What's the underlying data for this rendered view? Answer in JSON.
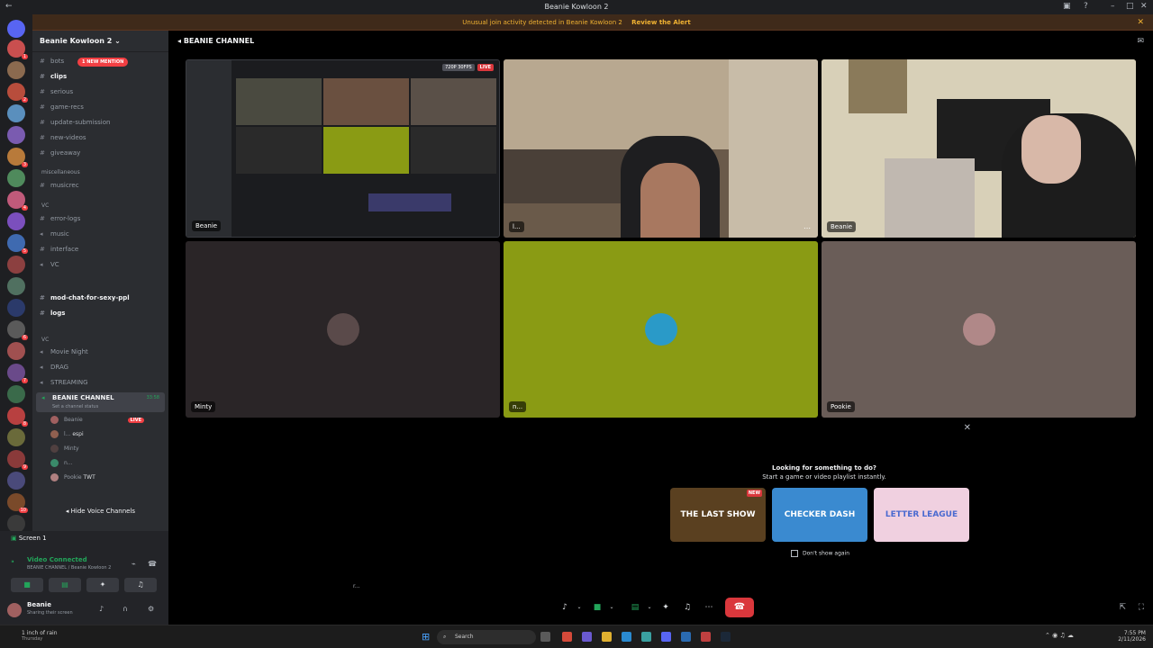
{
  "window": {
    "title": "Beanie Kowloon 2"
  },
  "alert": {
    "text": "Unusual join activity detected in Beanie Kowloon 2",
    "link": "Review the Alert"
  },
  "server_badges": [
    "1",
    "2",
    "3",
    "4",
    "5",
    "6",
    "7",
    "8",
    "9",
    "10"
  ],
  "sidebar": {
    "guild_name": "Beanie Kowloon 2",
    "mention_badge": "1 NEW MENTION",
    "channels": [
      {
        "label": "bots",
        "bold": false
      },
      {
        "label": "clips",
        "bold": true
      },
      {
        "label": "serious",
        "bold": false
      },
      {
        "label": "game-recs",
        "bold": false
      },
      {
        "label": "update-submission",
        "bold": false
      },
      {
        "label": "new-videos",
        "bold": false
      },
      {
        "label": "giveaway",
        "bold": false
      }
    ],
    "cat_misc": "miscellaneous",
    "misc_channels": [
      {
        "label": "musicrec"
      }
    ],
    "cat_vc": "VC",
    "vc_channels": [
      {
        "label": "error-logs"
      },
      {
        "label": "music"
      },
      {
        "label": "interface"
      },
      {
        "label": "VC"
      }
    ],
    "mod_channels": [
      {
        "label": "mod-chat-for-sexy-ppl"
      },
      {
        "label": "logs"
      }
    ],
    "cat_vc2": "VC",
    "voice_channels": [
      {
        "label": "Movie Night"
      },
      {
        "label": "DRAG"
      },
      {
        "label": "STREAMING"
      }
    ],
    "active_vc": {
      "label": "BEANIE CHANNEL",
      "count": "33:58",
      "status": "Set a channel status"
    },
    "members": [
      {
        "name": "Beanie",
        "tag": "LIVE"
      },
      {
        "name": "l...",
        "tag": "espi"
      },
      {
        "name": "Minty",
        "tag": ""
      },
      {
        "name": "n...",
        "tag": ""
      },
      {
        "name": "Pookie",
        "tag": "TWT"
      }
    ],
    "hide_vc": "Hide Voice Channels"
  },
  "panel": {
    "screen": "Screen 1",
    "video_connected": "Video Connected",
    "channel_path": "BEANIE CHANNEL / Beanie Kowloon 2",
    "user_name": "Beanie",
    "user_status": "Sharing their screen"
  },
  "main": {
    "channel_name": "BEANIE CHANNEL",
    "stream_quality": "720P 30FPS",
    "live": "LIVE",
    "tiles": [
      {
        "label": "Beanie"
      },
      {
        "label": "l..."
      },
      {
        "label": "Beanie"
      },
      {
        "label": "Minty"
      },
      {
        "label": "n..."
      },
      {
        "label": "Pookie"
      }
    ],
    "speaker_hint": "r..."
  },
  "promo": {
    "title": "Looking for something to do?",
    "subtitle": "Start a game or video playlist instantly.",
    "games": [
      {
        "name": "THE LAST SHOW",
        "badge": "NEW"
      },
      {
        "name": "CHECKER DASH",
        "badge": ""
      },
      {
        "name": "LETTER LEAGUE",
        "badge": ""
      }
    ],
    "dont_show": "Don't show again"
  },
  "taskbar": {
    "weather": "1 inch of rain",
    "weather_sub": "Thursday",
    "search": "Search",
    "time": "7:55 PM",
    "date": "2/11/2026"
  },
  "colors": {
    "alert": "#f0b232",
    "accent": "#23a55a",
    "danger": "#da373c",
    "tile_green": "#8a9b14"
  }
}
